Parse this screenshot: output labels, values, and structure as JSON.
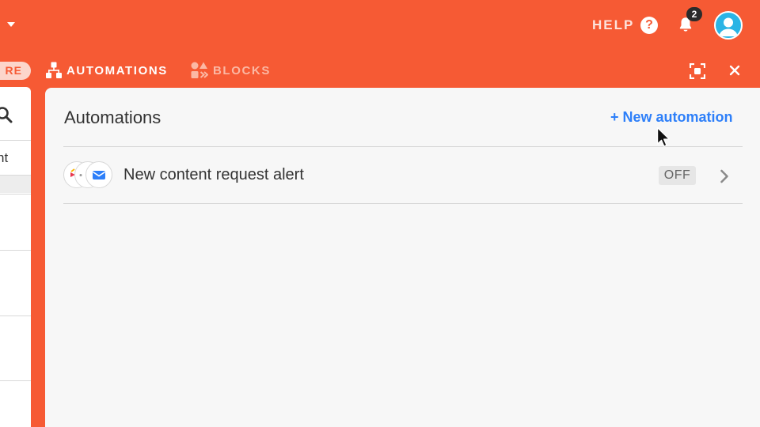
{
  "topbar": {
    "help_label": "HELP",
    "help_icon_glyph": "?",
    "notifications_count": "2"
  },
  "tabs": {
    "share_partial": "RE",
    "automations_label": "AUTOMATIONS",
    "blocks_label": "BLOCKS"
  },
  "left_panel": {
    "cell_text": "nt"
  },
  "panel": {
    "title": "Automations",
    "new_automation_label": "+ New automation",
    "automations": [
      {
        "name": "New content request alert",
        "status": "OFF"
      }
    ]
  },
  "colors": {
    "brand_bar": "#f65a34",
    "panel_bg": "#f7f7f7",
    "link_blue": "#2d7ff9",
    "avatar_blue": "#2ab4e5"
  },
  "icons": [
    "caret-down-icon",
    "help-icon",
    "bell-icon",
    "avatar-icon",
    "automations-icon",
    "blocks-icon",
    "expand-icon",
    "close-icon",
    "search-icon",
    "mail-icon",
    "chevron-right-icon",
    "mouse-cursor-icon"
  ]
}
